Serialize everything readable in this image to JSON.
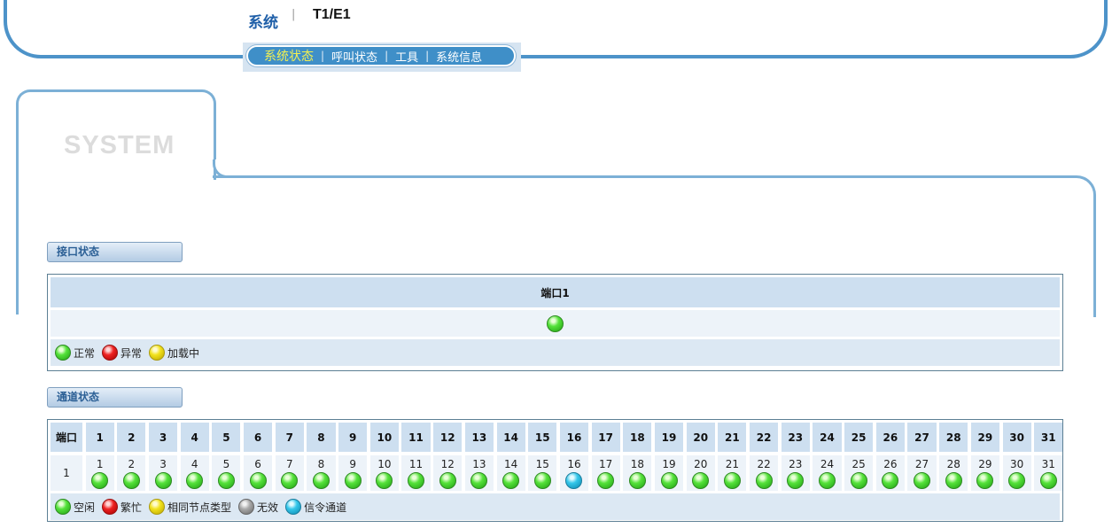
{
  "header": {
    "app_title": "系统",
    "separator": "|",
    "product": "T1/E1"
  },
  "nav": {
    "items": [
      "系统状态",
      "呼叫状态",
      "工具",
      "系统信息"
    ],
    "active_index": 0
  },
  "page": {
    "heading": "SYSTEM"
  },
  "interface_status": {
    "section_label": "接口状态",
    "port_header": "端口1",
    "port_state": "green",
    "legend": [
      {
        "color": "green",
        "label": "正常"
      },
      {
        "color": "red",
        "label": "异常"
      },
      {
        "color": "yellow",
        "label": "加载中"
      }
    ]
  },
  "channel_status": {
    "section_label": "通道状态",
    "corner_header": "端口",
    "port_label": "1",
    "channels": [
      {
        "n": "1",
        "s": "green"
      },
      {
        "n": "2",
        "s": "green"
      },
      {
        "n": "3",
        "s": "green"
      },
      {
        "n": "4",
        "s": "green"
      },
      {
        "n": "5",
        "s": "green"
      },
      {
        "n": "6",
        "s": "green"
      },
      {
        "n": "7",
        "s": "green"
      },
      {
        "n": "8",
        "s": "green"
      },
      {
        "n": "9",
        "s": "green"
      },
      {
        "n": "10",
        "s": "green"
      },
      {
        "n": "11",
        "s": "green"
      },
      {
        "n": "12",
        "s": "green"
      },
      {
        "n": "13",
        "s": "green"
      },
      {
        "n": "14",
        "s": "green"
      },
      {
        "n": "15",
        "s": "green"
      },
      {
        "n": "16",
        "s": "cyan"
      },
      {
        "n": "17",
        "s": "green"
      },
      {
        "n": "18",
        "s": "green"
      },
      {
        "n": "19",
        "s": "green"
      },
      {
        "n": "20",
        "s": "green"
      },
      {
        "n": "21",
        "s": "green"
      },
      {
        "n": "22",
        "s": "green"
      },
      {
        "n": "23",
        "s": "green"
      },
      {
        "n": "24",
        "s": "green"
      },
      {
        "n": "25",
        "s": "green"
      },
      {
        "n": "26",
        "s": "green"
      },
      {
        "n": "27",
        "s": "green"
      },
      {
        "n": "28",
        "s": "green"
      },
      {
        "n": "29",
        "s": "green"
      },
      {
        "n": "30",
        "s": "green"
      },
      {
        "n": "31",
        "s": "green"
      }
    ],
    "legend": [
      {
        "color": "green",
        "label": "空闲"
      },
      {
        "color": "red",
        "label": "繁忙"
      },
      {
        "color": "yellow",
        "label": "相同节点类型"
      },
      {
        "color": "gray",
        "label": "无效"
      },
      {
        "color": "cyan",
        "label": "信令通道"
      }
    ]
  }
}
